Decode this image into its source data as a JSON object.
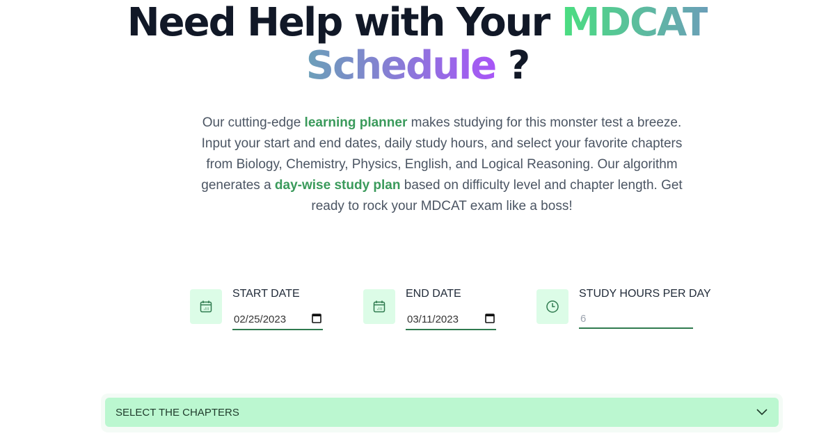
{
  "hero": {
    "title_part1": "Need Help with Your ",
    "title_highlight1": "MDCAT",
    "title_highlight2": "Schedule",
    "title_suffix": " ?",
    "desc_1": "Our cutting-edge ",
    "desc_hl1": "learning planner",
    "desc_2": " makes studying for this monster test a breeze. Input your start and end dates, daily study hours, and select your favorite chapters from Biology, Chemistry, Physics, English, and Logical Reasoning. Our algorithm generates a ",
    "desc_hl2": "day-wise study plan",
    "desc_3": " based on difficulty level and chapter length. Get ready to rock your MDCAT exam like a boss!"
  },
  "form": {
    "start_date": {
      "label": "START DATE",
      "value": "02/25/2023",
      "icon": "calendar-icon"
    },
    "end_date": {
      "label": "END DATE",
      "value": "03/11/2023",
      "icon": "calendar-icon"
    },
    "hours": {
      "label": "STUDY HOURS PER DAY",
      "placeholder": "6",
      "icon": "clock-icon"
    }
  },
  "chapters": {
    "label": "SELECT THE CHAPTERS",
    "icon": "chevron-down-icon"
  },
  "colors": {
    "accent": "#3a9a5b",
    "icon_bg": "#dcfce7",
    "accordion_bg": "#bbf7d0"
  }
}
